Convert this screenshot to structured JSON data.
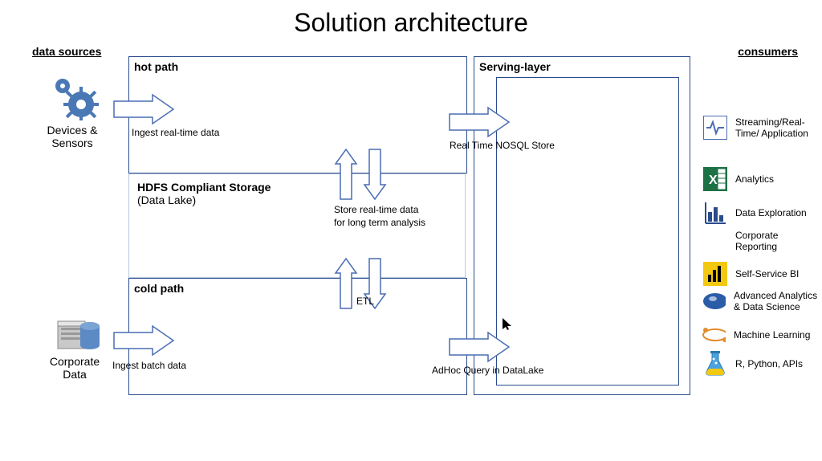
{
  "title": "Solution architecture",
  "sections": {
    "sources": "data sources",
    "consumers": "consumers"
  },
  "sources": {
    "devices": "Devices & Sensors",
    "corporate": "Corporate Data"
  },
  "paths": {
    "hot": {
      "title": "hot path",
      "ingest": "Ingest real-time data",
      "serve": "Real Time NOSQL Store"
    },
    "cold": {
      "title": "cold path",
      "ingest": "Ingest batch data",
      "etl": "ETL",
      "serve": "AdHoc Query in DataLake"
    }
  },
  "storage": {
    "title": "HDFS Compliant Storage",
    "subtitle": "(Data Lake)",
    "note": "Store real-time data\nfor long term analysis"
  },
  "serving": {
    "title": "Serving-layer"
  },
  "consumers": [
    {
      "icon": "pulse-icon",
      "label": "Streaming/Real-Time/ Application"
    },
    {
      "icon": "excel-icon",
      "label": "Analytics"
    },
    {
      "icon": "bars-icon",
      "label": "Data Exploration"
    },
    {
      "icon": "",
      "label": "Corporate Reporting"
    },
    {
      "icon": "powerbi-icon",
      "label": "Self-Service BI"
    },
    {
      "icon": "lens-icon",
      "label": "Advanced Analytics & Data Science"
    },
    {
      "icon": "ml-icon",
      "label": "Machine Learning"
    },
    {
      "icon": "flask-icon",
      "label": "R, Python, APIs"
    }
  ]
}
